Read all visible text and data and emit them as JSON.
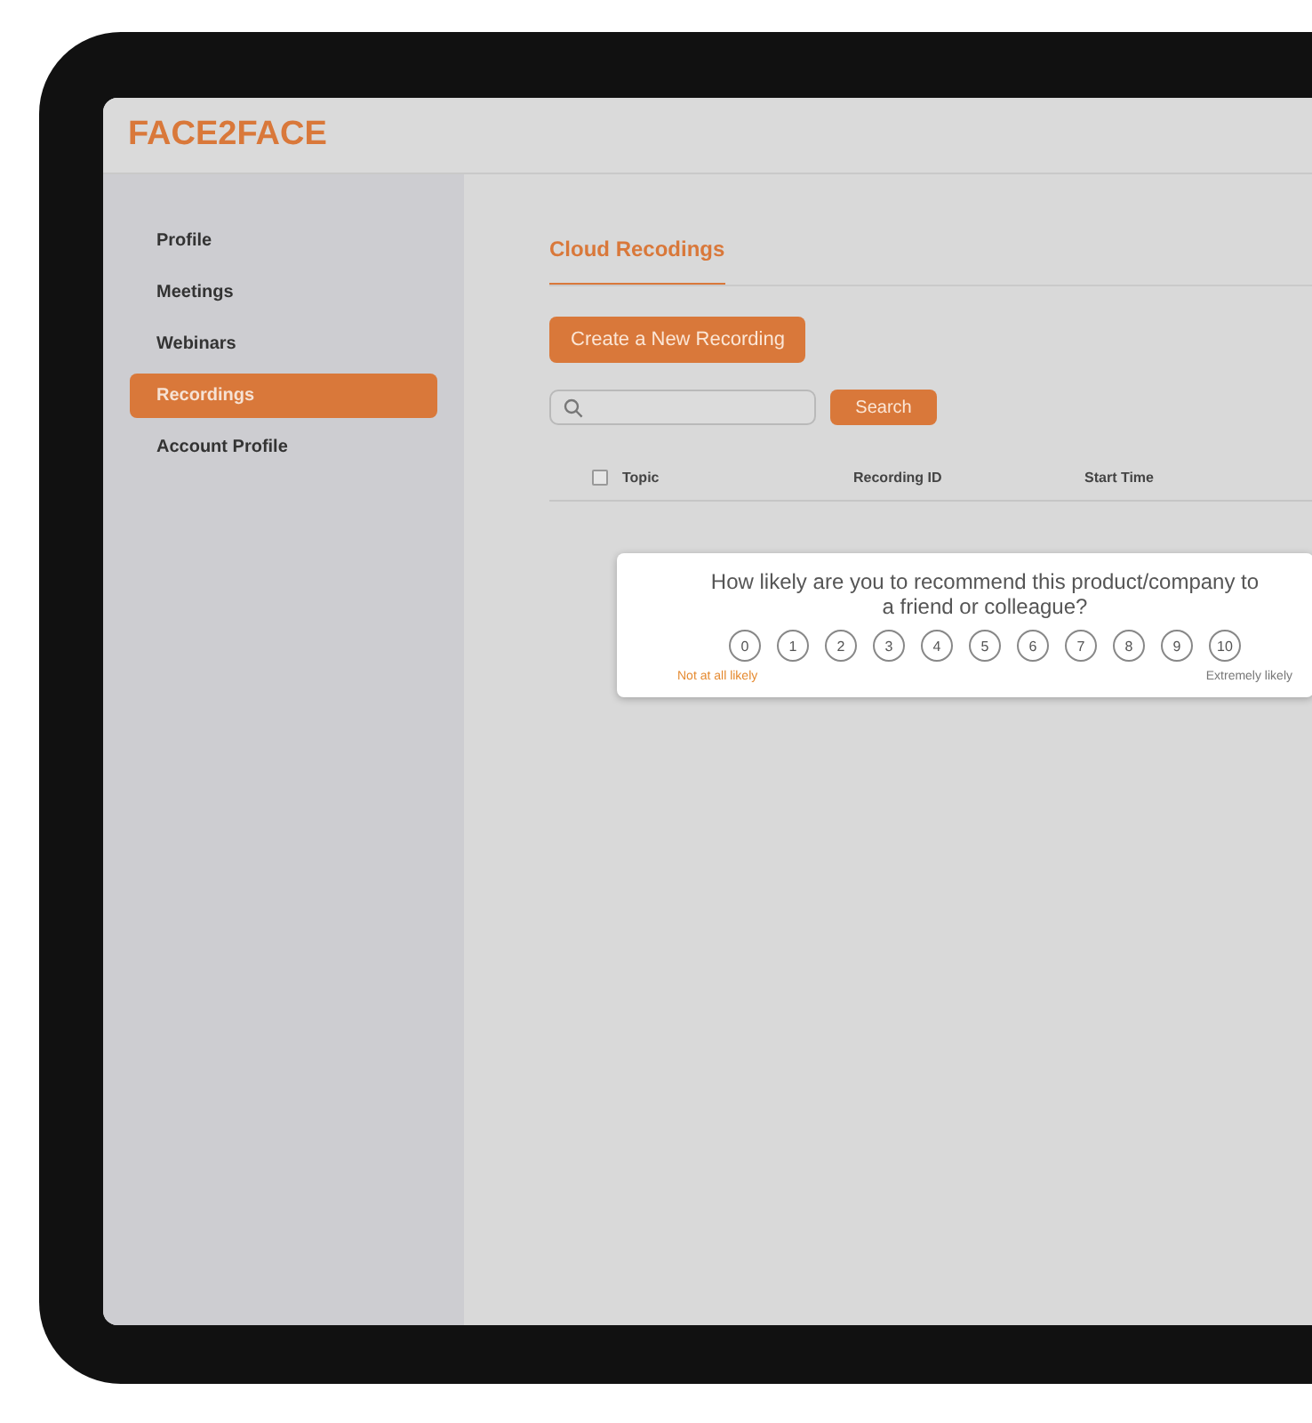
{
  "app": {
    "logo": "FACE2FACE"
  },
  "sidebar": {
    "items": [
      {
        "label": "Profile",
        "selected": false
      },
      {
        "label": "Meetings",
        "selected": false
      },
      {
        "label": "Webinars",
        "selected": false
      },
      {
        "label": "Recordings",
        "selected": true
      },
      {
        "label": "Account Profile",
        "selected": false
      }
    ]
  },
  "main": {
    "tab": "Cloud Recodings",
    "create_button": "Create a New Recording",
    "search_button": "Search",
    "table": {
      "select_all_checked": false,
      "columns": [
        "Topic",
        "Recording ID",
        "Start Time"
      ]
    }
  },
  "survey": {
    "question": "How likely are you to recommend this product/company to a friend or colleague?",
    "scores": [
      "0",
      "1",
      "2",
      "3",
      "4",
      "5",
      "6",
      "7",
      "8",
      "9",
      "10"
    ],
    "low_label": "Not at all likely",
    "high_label": "Extremely likely"
  }
}
